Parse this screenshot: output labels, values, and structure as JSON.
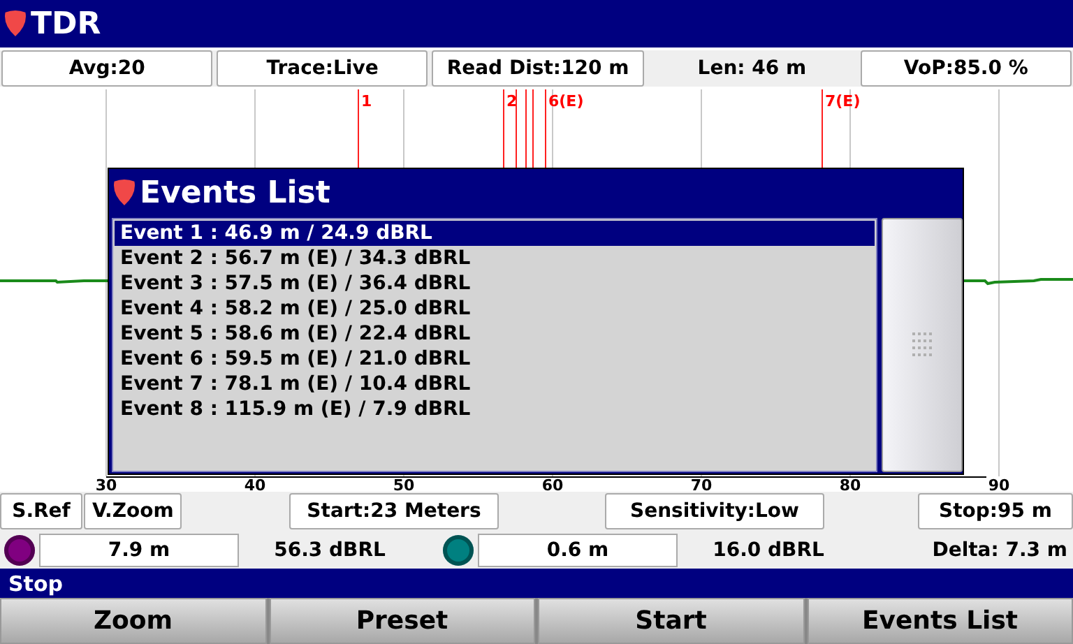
{
  "window": {
    "title": "TDR"
  },
  "top_bar": [
    {
      "kind": "button",
      "label": "Avg:20"
    },
    {
      "kind": "button",
      "label": "Trace:Live"
    },
    {
      "kind": "button",
      "label": "Read Dist:120 m"
    },
    {
      "kind": "label",
      "label": "Len: 46 m"
    },
    {
      "kind": "button",
      "label": "VoP:85.0 %"
    }
  ],
  "chart": {
    "axis_labels": [
      "30",
      "40",
      "50",
      "60",
      "70",
      "80",
      "90"
    ],
    "markers": [
      {
        "kind": "labeled",
        "label": "1"
      },
      {
        "kind": "labeled",
        "label": "2"
      },
      {
        "kind": "plain"
      },
      {
        "kind": "plain"
      },
      {
        "kind": "plain"
      },
      {
        "kind": "labeled",
        "label": "6(E)"
      },
      {
        "kind": "labeled",
        "label": "7(E)"
      }
    ]
  },
  "events_dialog": {
    "title": "Events List",
    "items": [
      {
        "text": "Event 1 : 46.9 m / 24.9 dBRL",
        "selected": true
      },
      {
        "text": "Event 2 : 56.7 m (E) / 34.3 dBRL",
        "selected": false
      },
      {
        "text": "Event 3 : 57.5 m (E) / 36.4 dBRL",
        "selected": false
      },
      {
        "text": "Event 4 : 58.2 m (E) / 25.0 dBRL",
        "selected": false
      },
      {
        "text": "Event 5 : 58.6 m (E) / 22.4 dBRL",
        "selected": false
      },
      {
        "text": "Event 6 : 59.5 m (E) / 21.0 dBRL",
        "selected": false
      },
      {
        "text": "Event 7 : 78.1 m (E) / 10.4 dBRL",
        "selected": false
      },
      {
        "text": "Event 8 : 115.9 m (E) / 7.9 dBRL",
        "selected": false
      }
    ]
  },
  "controls": [
    "S.Ref",
    "V.Zoom",
    "Start:23 Meters",
    "Sensitivity:Low",
    "Stop:95 m"
  ],
  "cursors": [
    {
      "color": "#800080",
      "distance": "7.9 m",
      "reading": "56.3 dBRL"
    },
    {
      "color": "#008080",
      "distance": "0.6 m",
      "reading": "16.0 dBRL"
    }
  ],
  "delta": "Delta: 7.3 m",
  "status_bar": "Stop",
  "softkeys": [
    "Zoom",
    "Preset",
    "Start",
    "Events List"
  ]
}
